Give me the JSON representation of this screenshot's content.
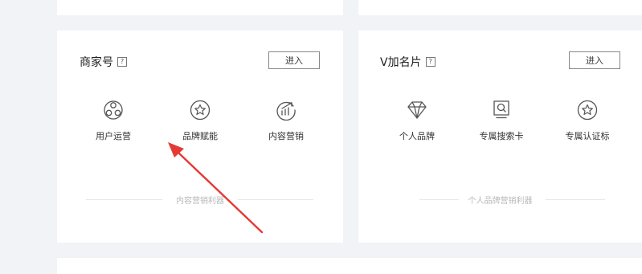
{
  "cards": [
    {
      "title": "商家号",
      "help": "?",
      "enter_label": "进入",
      "features": [
        {
          "label": "用户运营",
          "icon": "user-group-icon"
        },
        {
          "label": "品牌赋能",
          "icon": "star-badge-icon"
        },
        {
          "label": "内容营销",
          "icon": "growth-chart-icon"
        }
      ],
      "footer": "内容营销利器"
    },
    {
      "title": "V加名片",
      "help": "?",
      "enter_label": "进入",
      "features": [
        {
          "label": "个人品牌",
          "icon": "diamond-icon"
        },
        {
          "label": "专属搜索卡",
          "icon": "search-card-icon"
        },
        {
          "label": "专属认证标",
          "icon": "star-badge-icon"
        }
      ],
      "footer": "个人品牌营销利器"
    }
  ],
  "annotation": {
    "color": "#e53935"
  }
}
